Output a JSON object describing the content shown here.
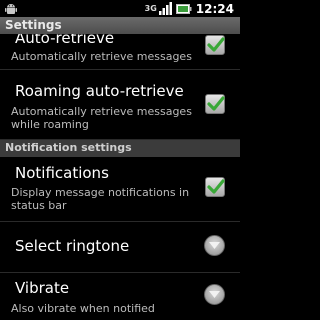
{
  "status_bar": {
    "time": "12:24",
    "network_type": "3G",
    "icons": [
      "android-notification-icon",
      "network-3g-icon",
      "signal-icon",
      "battery-icon"
    ]
  },
  "title_bar": {
    "title": "Settings"
  },
  "sections": {
    "download_settings": {
      "auto_retrieve": {
        "title": "Auto-retrieve",
        "summary": "Automatically retrieve messages",
        "checked": true
      },
      "roaming_auto_retrieve": {
        "title": "Roaming auto-retrieve",
        "summary": "Automatically retrieve messages while roaming",
        "checked": true
      }
    },
    "notification_settings": {
      "header": "Notification settings",
      "notifications": {
        "title": "Notifications",
        "summary": "Display message notifications in status bar",
        "checked": true
      },
      "select_ringtone": {
        "title": "Select ringtone"
      },
      "vibrate": {
        "title": "Vibrate",
        "summary": "Also vibrate when notified"
      }
    }
  },
  "colors": {
    "background": "#000000",
    "checkmark": "#39a837",
    "header_bg": "#3b3b3b",
    "title_bar_bg": "#5c5c5c"
  }
}
